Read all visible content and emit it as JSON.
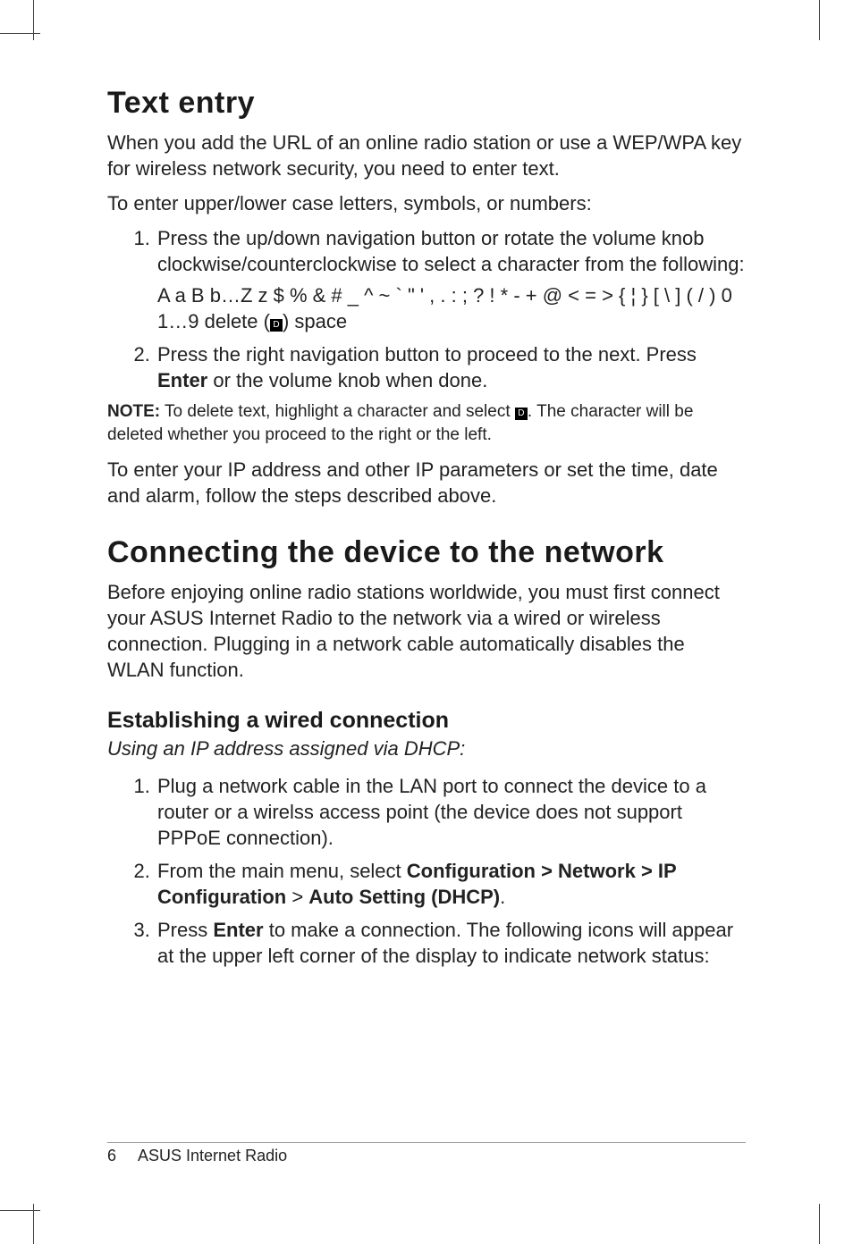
{
  "section1": {
    "heading": "Text entry",
    "p1": "When you add the URL of an online radio station or use a WEP/WPA key for wireless network security, you need to enter text.",
    "p2": "To enter upper/lower case letters, symbols, or numbers:",
    "li1": "Press the up/down navigation button or rotate the volume knob clockwise/counterclockwise to select a character from the following:",
    "chars1": "A a B b…Z z $ % & # _ ^ ~ ` \" ' , . : ; ? ! * - + @ < = > { ¦ } [ \\ ] ( / ) 0 1…9 delete (",
    "chars2": ") space",
    "li2a": "Press the right navigation button to proceed to the next. Press ",
    "li2b": "Enter",
    "li2c": " or the volume knob when done.",
    "note_label": "NOTE:",
    "note1a": " To delete text, highlight a character and select ",
    "note1b": ". The character will be deleted whether you proceed to the right or the left.",
    "p3": "To enter your IP address and other IP parameters or set the time, date and alarm, follow the steps described above."
  },
  "section2": {
    "heading": "Connecting the device to the network",
    "p1": "Before enjoying online radio stations worldwide, you must first connect your ASUS Internet Radio to the network via a wired or wireless connection. Plugging in a network cable automatically disables the WLAN function.",
    "sub_heading": "Establishing a wired connection",
    "sub_sub": "Using an IP address assigned via DHCP:",
    "li1": "Plug a network cable in the LAN port to connect the device to a router or a wirelss access point (the device does not support PPPoE connection).",
    "li2a": "From the main menu, select ",
    "li2b": "Configuration > Network > IP Configuration",
    "li2c": " > ",
    "li2d": "Auto Setting (DHCP)",
    "li2e": ".",
    "li3a": "Press ",
    "li3b": "Enter",
    "li3c": " to make a connection. The following icons will appear at the upper left corner of the display to indicate network status:"
  },
  "footer": {
    "page": "6",
    "title": "ASUS Internet Radio"
  },
  "icon": {
    "del_glyph": "D"
  }
}
